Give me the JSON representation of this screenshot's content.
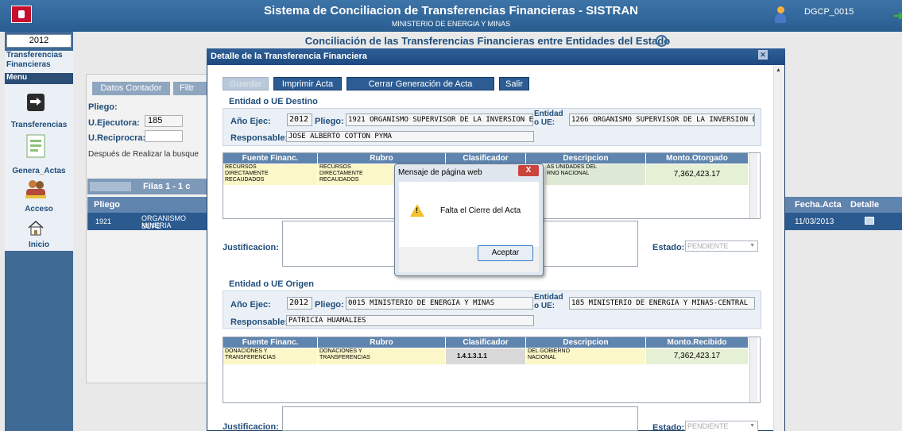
{
  "app": {
    "title": "Sistema de Conciliacion de Transferencias Financieras - SISTRAN",
    "subtitle": "MINISTERIO DE ENERGIA Y MINAS",
    "user": "DGCP_0015"
  },
  "sidebar": {
    "year": "2012",
    "section": "Transferencias Financieras",
    "menu": "Menu",
    "items": [
      {
        "label": "Transferencias",
        "icon": "transfer-arrows-icon"
      },
      {
        "label": "Genera_Actas",
        "icon": "document-icon"
      },
      {
        "label": "Acceso",
        "icon": "users-icon"
      },
      {
        "label": "Inicio",
        "icon": "home-icon"
      }
    ]
  },
  "background": {
    "heading": "Conciliación de las Transferencias Financieras entre Entidades del Estado",
    "tab_datos": "Datos Contador",
    "tab_filtro": "Filtr",
    "pliego_label": "Pliego:",
    "ue_label": "U.Ejecutora:",
    "ue_value": "185",
    "urec_label": "U.Reciprocra:",
    "note": "Después de Realizar la busque",
    "filas": "Filas 1 - 1 c",
    "col_pliego": "Pliego",
    "row_pliego": "1921",
    "row_name_1": "ORGANISMO SUPE",
    "row_name_2": "MINERIA",
    "col_fecha": "Fecha.Acta",
    "col_detalle": "Detalle",
    "row_fecha": "11/03/2013"
  },
  "modal": {
    "title": "Detalle de la Transferencia Financiera",
    "buttons": {
      "guardar": "Guardar",
      "imprimir": "Imprimir Acta",
      "cerrar": "Cerrar Generación de Acta",
      "salir": "Salir"
    },
    "destino": {
      "title": "Entidad o UE Destino",
      "ano_label": "Año Ejec:",
      "ano": "2012",
      "pliego_label": "Pliego:",
      "pliego": "1921 ORGANISMO SUPERVISOR DE LA INVERSION E",
      "entidad_label_1": "Entidad",
      "entidad_label_2": "o UE:",
      "entidad": "1266 ORGANISMO SUPERVISOR DE LA INVERSION E",
      "resp_label": "Responsable:",
      "resp": "JOSE ALBERTO COTTON PYMA",
      "cols": [
        "Fuente Financ.",
        "Rubro",
        "Clasificador",
        "Descripcion",
        "Monto.Otorgado"
      ],
      "row": {
        "fuente_1": "RECURSOS",
        "fuente_2": "DIRECTAMENTE",
        "fuente_3": "RECAUDADOS",
        "rubro_1": "RECURSOS",
        "rubro_2": "DIRECTAMENTE",
        "rubro_3": "RECAUDADOS",
        "desc_1": "AS UNIDADES DEL",
        "desc_2": "RNO NACIONAL",
        "monto": "7,362,423.17"
      },
      "just_label": "Justificacion:",
      "estado_label": "Estado:",
      "estado": "PENDIENTE"
    },
    "origen": {
      "title": "Entidad o UE Origen",
      "ano_label": "Año Ejec:",
      "ano": "2012",
      "pliego_label": "Pliego:",
      "pliego": "0015 MINISTERIO DE ENERGIA Y MINAS",
      "entidad_label_1": "Entidad",
      "entidad_label_2": "o UE:",
      "entidad": "185 MINISTERIO DE ENERGIA Y MINAS-CENTRAL",
      "resp_label": "Responsable:",
      "resp": "PATRICIA HUAMALIES",
      "cols": [
        "Fuente Financ.",
        "Rubro",
        "Clasificador",
        "Descripcion",
        "Monto.Recibido"
      ],
      "row": {
        "fuente_1": "DONACIONES Y",
        "fuente_2": "TRANSFERENCIAS",
        "rubro_1": "DONACIONES Y",
        "rubro_2": "TRANSFERENCIAS",
        "clasif": "1.4.1.3.1.1",
        "desc_1": "DEL GOBIERNO",
        "desc_2": "NACIONAL",
        "monto": "7,362,423.17"
      },
      "just_label": "Justificacion:",
      "estado_label": "Estado:",
      "estado": "PENDIENTE"
    }
  },
  "alert": {
    "title": "Mensaje de página web",
    "message": "Falta el Cierre del Acta",
    "ok": "Aceptar",
    "close": "X"
  },
  "colors": {
    "header": "#2f5f98",
    "accent": "#1f4d7a",
    "panel": "#eaf0f6"
  }
}
